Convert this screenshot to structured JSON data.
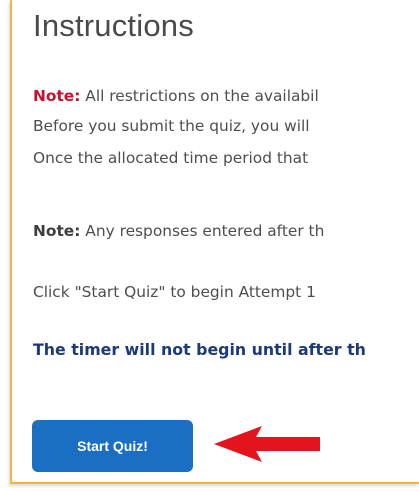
{
  "heading": "Instructions",
  "lines": {
    "l1_prefix": "Note:",
    "l1_text": " All restrictions on the availabil",
    "l2_text": "Before you submit the quiz, you will",
    "l3_text": "Once the allocated time period that",
    "l4_prefix": "Note:",
    "l4_text": " Any responses entered after th",
    "l5_text": "Click \"Start Quiz\" to begin Attempt 1",
    "l6_text": "The timer will not begin until after th"
  },
  "button": {
    "label": "Start Quiz!"
  },
  "icons": {
    "arrow": "red-left-arrow-icon"
  },
  "colors": {
    "note_red": "#c8102e",
    "timer_blue": "#1d3a78",
    "button_blue": "#1a6fc4",
    "frame_border": "#f2b544",
    "arrow_red": "#e3141e"
  }
}
